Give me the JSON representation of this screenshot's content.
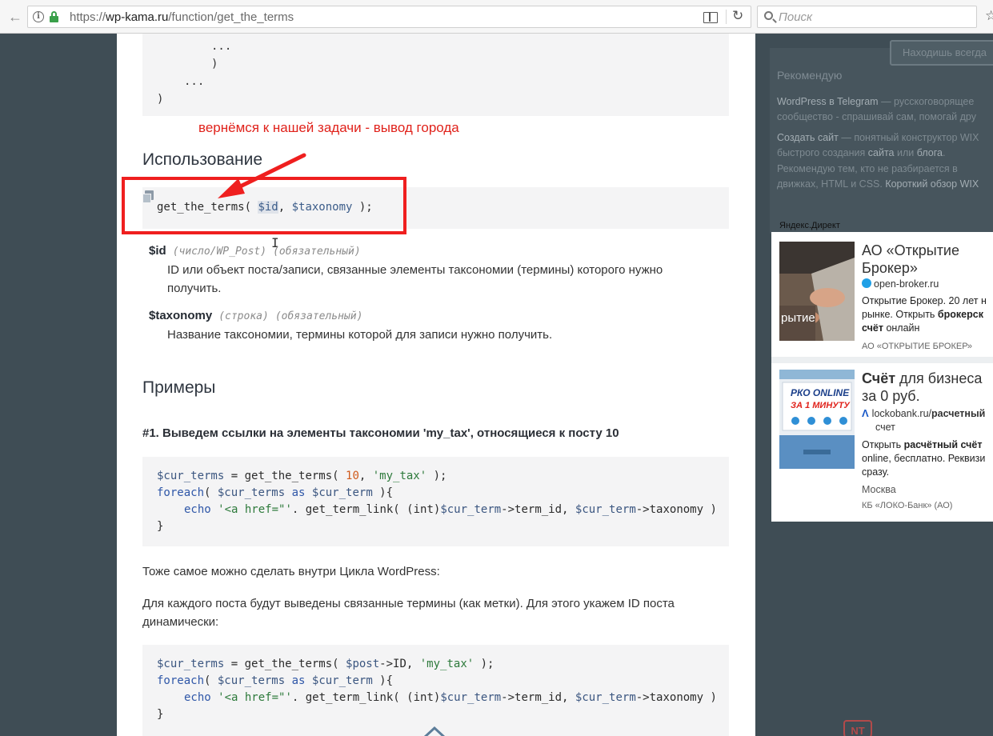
{
  "browser": {
    "url_prefix": "https://",
    "url_host": "wp-kama.ru",
    "url_path": "/function/get_the_terms",
    "search_placeholder": "Поиск"
  },
  "code_top": {
    "lines": [
      ")",
      "...",
      ")",
      "...",
      ")"
    ]
  },
  "annotation": {
    "text": "вернёмся к нашей задачи - вывод города",
    "color": "#e0221b"
  },
  "usage": {
    "heading": "Использование",
    "code_fn": "get_the_terms( ",
    "code_id": "$id",
    "code_mid": ", ",
    "code_tax": "$taxonomy",
    "code_end": " );"
  },
  "params": [
    {
      "name": "$id",
      "type": "(число/WP_Post)",
      "required": "(обязательный)",
      "desc_line1": "ID или объект поста/записи, связанные элементы таксономии (термины) которого нужно",
      "desc_line2": "получить."
    },
    {
      "name": "$taxonomy",
      "type": "(строка)",
      "required": "(обязательный)",
      "desc_line1": "Название таксономии, термины которой для записи нужно получить."
    }
  ],
  "examples": {
    "heading": "Примеры",
    "ex1_title": "#1. Выведем ссылки на элементы таксономии 'my_tax', относящиеся к посту 10",
    "ex1": {
      "l1_var": "$cur_terms",
      "l1_eq": " = get_the_terms( ",
      "l1_num": "10",
      "l1_comma": ", ",
      "l1_str": "'my_tax'",
      "l1_end": " );",
      "l2_kw": "foreach",
      "l2_open": "( ",
      "l2_var1": "$cur_terms",
      "l2_as": " as ",
      "l2_var2": "$cur_term",
      "l2_end": " ){",
      "l3_kw": "echo",
      "l3_str": "'<a href=\"'",
      "l3_rest1": ". get_term_link( (int)",
      "l3_var1": "$cur_term",
      "l3_rest2": "->term_id, ",
      "l3_var2": "$cur_term",
      "l3_rest3": "->taxonomy )",
      "l4": "}"
    },
    "para1": "Тоже самое можно сделать внутри Цикла WordPress:",
    "para2": "Для каждого поста будут выведены связанные термины (как метки). Для этого укажем ID поста динамически:",
    "ex2": {
      "l1_var": "$cur_terms",
      "l1_eq": " = get_the_terms( ",
      "l1_var2": "$post",
      "l1_id": "->ID, ",
      "l1_str": "'my_tax'",
      "l1_end": " );",
      "l2_kw": "foreach",
      "l2_open": "( ",
      "l2_var1": "$cur_terms",
      "l2_as": " as ",
      "l2_var2": "$cur_term",
      "l2_end": " ){",
      "l3_kw": "echo",
      "l3_str": "'<a href=\"'",
      "l3_rest1": ". get_term_link( (int)",
      "l3_var1": "$cur_term",
      "l3_rest2": "->term_id, ",
      "l3_var2": "$cur_term",
      "l3_rest3": "->taxonomy )",
      "l4": "}"
    }
  },
  "sidebar": {
    "find_button": "Находишь всегда",
    "rec_title": "Рекомендую",
    "rec1_a": "WordPress в Telegram",
    "rec1_b": " — русскоговорящее",
    "rec2": "сообщество - спрашивай сам, помогай дру",
    "rec3_a": "Создать сайт",
    "rec3_b": " — понятный конструктор WIX",
    "rec4_a": "быстрого создания ",
    "rec4_b": "сайта",
    "rec4_c": " или ",
    "rec4_d": "блога",
    "rec4_e": ".",
    "rec5": "Рекомендую тем, кто не разбирается в",
    "rec6_a": "движках, HTML и CSS. ",
    "rec6_b": "Короткий обзор WIX",
    "ad_label": "Яндекс.Директ",
    "ad1": {
      "title1": "АО «Открытие",
      "title2": "Брокер»",
      "domain": "open-broker.ru",
      "desc1": "Открытие Брокер. 20 лет н",
      "desc2a": "рынке. Открыть ",
      "desc2b": "брокерск",
      "desc3a": "счёт",
      "desc3b": " онлайн",
      "owner": "АО «ОТКРЫТИЕ БРОКЕР»",
      "img_text": "рытие"
    },
    "ad2": {
      "title1a": "Счёт",
      "title1b": " для бизнеса ",
      "title2": "за 0 руб.",
      "domain_a": "lockobank.ru/",
      "domain_b": "расчетный",
      "domain2": "счет",
      "desc1a": "Открыть ",
      "desc1b": "расчётный счёт",
      "desc2": "online, бесплатно. Реквизи",
      "desc3": "сразу.",
      "city": "Москва",
      "owner": "КБ «ЛОКО-Банк» (АО)",
      "img_line1": "РКО ONLINE",
      "img_line2": "ЗА 1 МИНУТУ"
    }
  }
}
